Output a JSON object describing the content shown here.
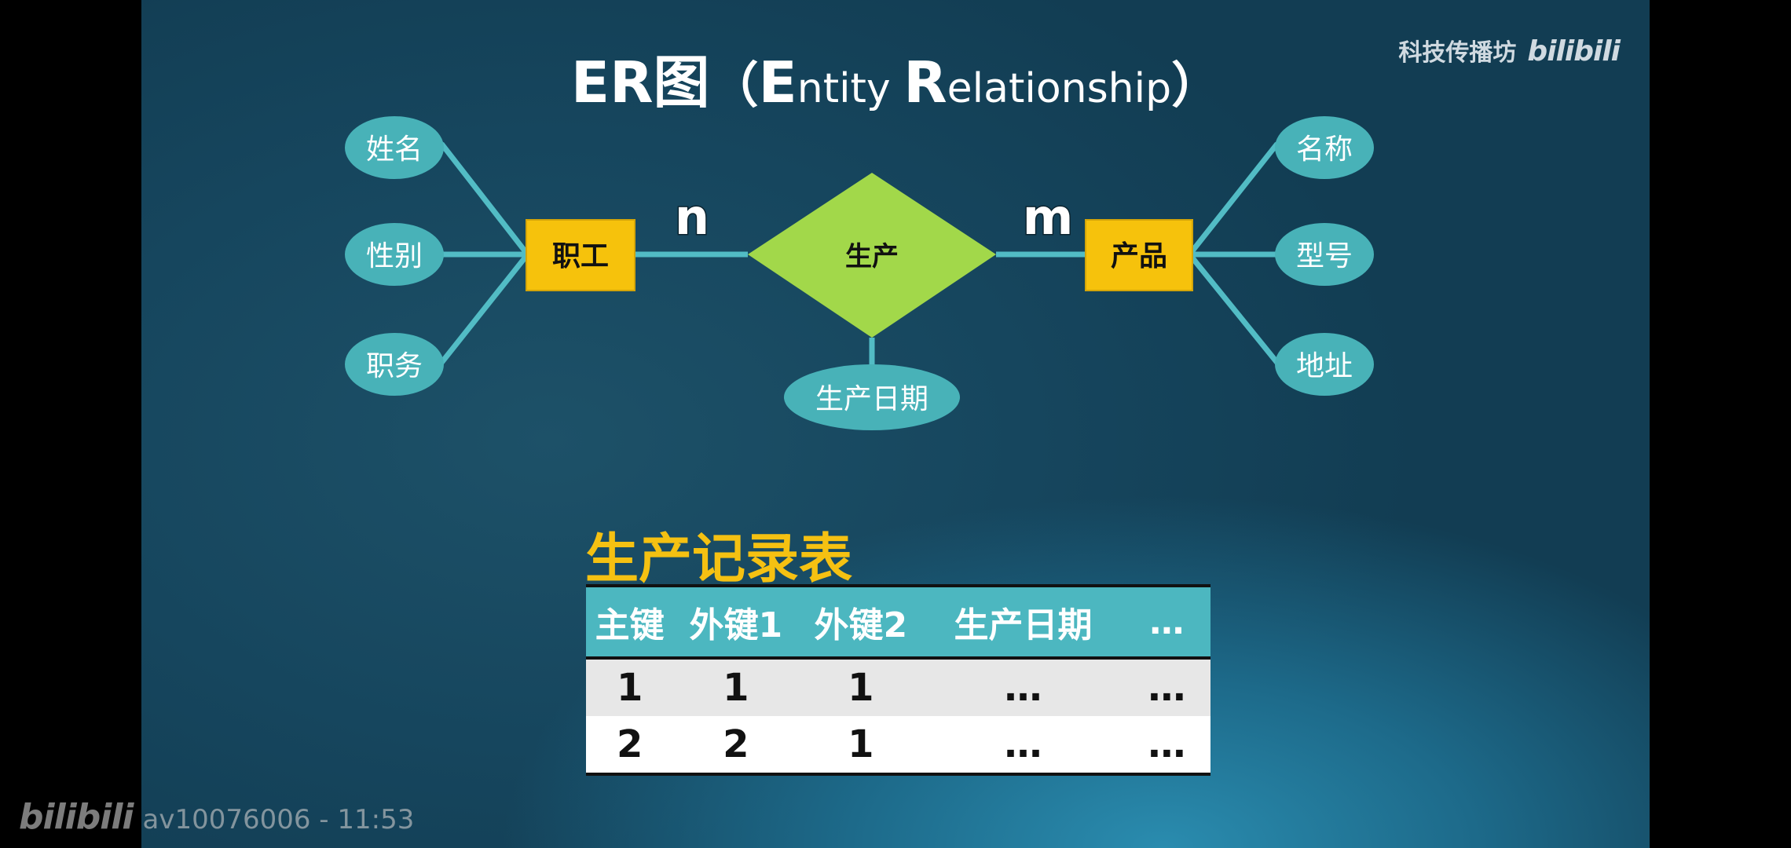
{
  "slide": {
    "title_parts": [
      "ER图",
      "（",
      "E",
      "ntity ",
      "R",
      "elationship",
      "）"
    ],
    "channel_name": "科技传播坊",
    "channel_logo": "bilibili"
  },
  "er_diagram": {
    "entities": [
      {
        "id": "employee",
        "label": "职工"
      },
      {
        "id": "product",
        "label": "产品"
      }
    ],
    "relationship": {
      "id": "produce",
      "label": "生产"
    },
    "attributes": [
      {
        "entity": "employee",
        "label": "姓名"
      },
      {
        "entity": "employee",
        "label": "性别"
      },
      {
        "entity": "employee",
        "label": "职务"
      },
      {
        "entity": "product",
        "label": "名称"
      },
      {
        "entity": "product",
        "label": "型号"
      },
      {
        "entity": "product",
        "label": "地址"
      },
      {
        "entity": "produce",
        "label": "生产日期"
      }
    ],
    "cardinality": {
      "employee_side": "n",
      "product_side": "m"
    },
    "colors": {
      "entity": "#f6c20c",
      "relationship": "#a2d84a",
      "attribute": "#48b2b8",
      "connector": "#52bcc5"
    }
  },
  "record_table": {
    "title": "生产记录表",
    "headers": [
      "主键",
      "外键1",
      "外键2",
      "生产日期",
      "…"
    ],
    "rows": [
      [
        "1",
        "1",
        "1",
        "…",
        "…"
      ],
      [
        "2",
        "2",
        "1",
        "…",
        "…"
      ]
    ],
    "colors": {
      "title": "#f5c112",
      "header_bg": "#4cb7c0"
    }
  },
  "overlay": {
    "logo": "bilibili",
    "video_info": "av10076006 - 11:53"
  }
}
